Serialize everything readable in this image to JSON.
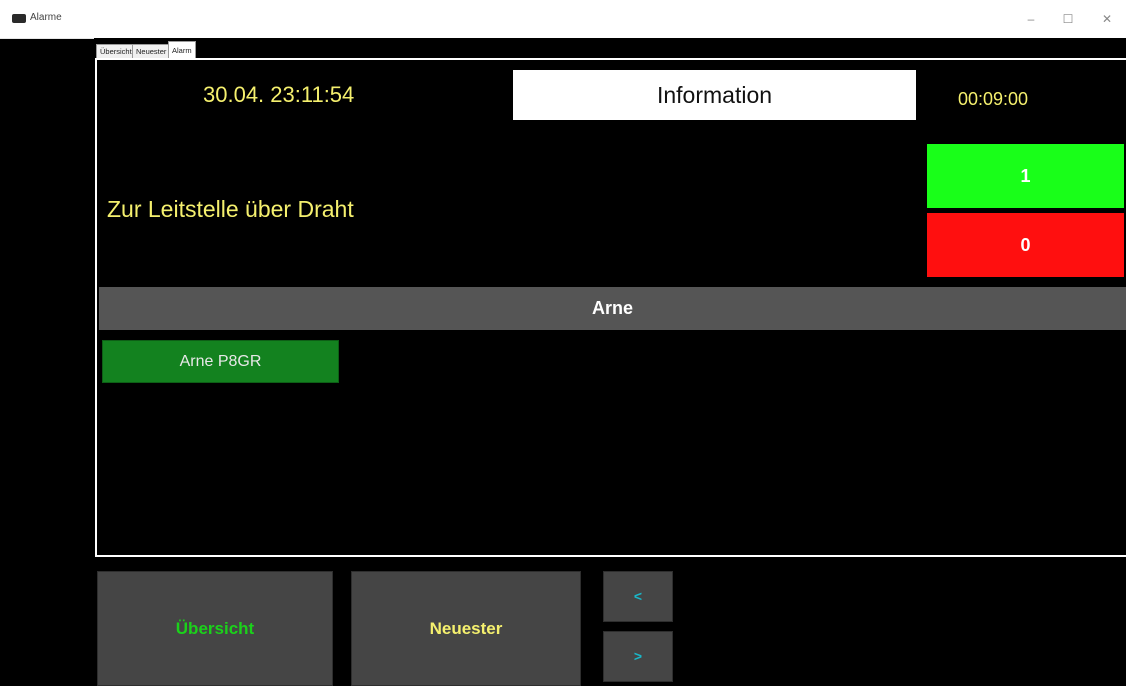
{
  "window": {
    "title": "Alarme",
    "minimize": "–",
    "maximize": "☐",
    "close": "✕"
  },
  "tabs": [
    {
      "label": "Übersicht"
    },
    {
      "label": "Neuester"
    },
    {
      "label": "Alarm"
    }
  ],
  "header": {
    "datetime": "30.04. 23:11:54",
    "info": "Information",
    "timer": "00:09:00"
  },
  "message": "Zur Leitstelle über Draht",
  "counters": {
    "positive": "1",
    "negative": "0"
  },
  "group": {
    "title": "Arne",
    "units": [
      "Arne P8GR"
    ]
  },
  "nav": {
    "overview": "Übersicht",
    "newest": "Neuester",
    "prev": "<",
    "next": ">"
  },
  "colors": {
    "background": "#000000",
    "accent_yellow": "#f5f06e",
    "positive": "#19ff19",
    "negative": "#ff0f0f",
    "unit_green": "#13821f",
    "button_gray": "#454545"
  }
}
